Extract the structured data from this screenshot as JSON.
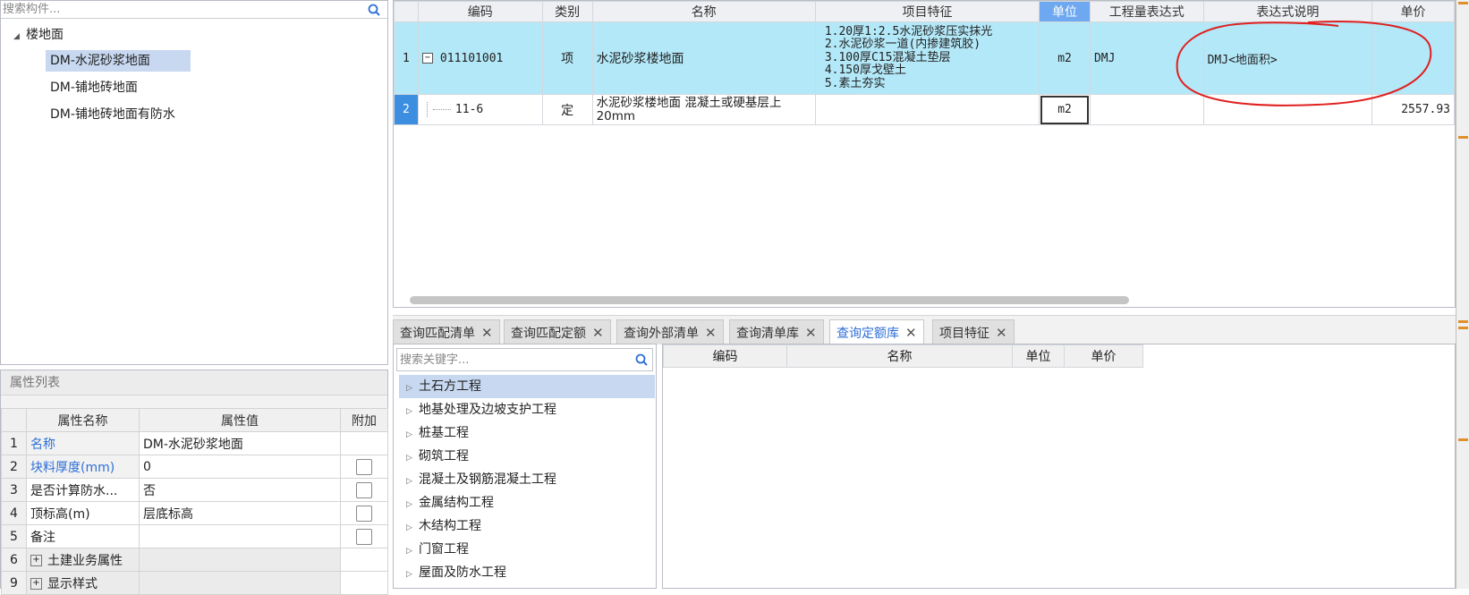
{
  "component_search": {
    "placeholder": "搜索构件..."
  },
  "tree": {
    "root": "楼地面",
    "items": [
      "DM-水泥砂浆地面",
      "DM-铺地砖地面",
      "DM-铺地砖地面有防水"
    ]
  },
  "properties": {
    "title": "属性列表",
    "headers": [
      "属性名称",
      "属性值",
      "附加"
    ],
    "rows": [
      {
        "num": "1",
        "name": "名称",
        "value": "DM-水泥砂浆地面"
      },
      {
        "num": "2",
        "name": "块料厚度(mm)",
        "value": "0"
      },
      {
        "num": "3",
        "name": "是否计算防水...",
        "value": "否"
      },
      {
        "num": "4",
        "name": "顶标高(m)",
        "value": "层底标高"
      },
      {
        "num": "5",
        "name": "备注",
        "value": ""
      },
      {
        "num": "6",
        "name": "土建业务属性",
        "value": ""
      },
      {
        "num": "9",
        "name": "显示样式",
        "value": ""
      }
    ]
  },
  "grid": {
    "headers": [
      "编码",
      "类别",
      "名称",
      "项目特征",
      "单位",
      "工程量表达式",
      "表达式说明",
      "单价"
    ],
    "rows": [
      {
        "num": "1",
        "code": "011101001",
        "type": "项",
        "name": "水泥砂浆楼地面",
        "features": [
          "1.20厚1:2.5水泥砂浆压实抹光",
          "2.水泥砂浆一道(内掺建筑胶)",
          "3.100厚C15混凝土垫层",
          "4.150厚戈壁土",
          "5.素土夯实"
        ],
        "unit": "m2",
        "expr": "DMJ",
        "expr_desc": "DMJ<地面积>",
        "price": ""
      },
      {
        "num": "2",
        "code": "11-6",
        "type": "定",
        "name": "水泥砂浆楼地面 混凝土或硬基层上 20mm",
        "features": [],
        "unit": "m2",
        "expr": "",
        "expr_desc": "",
        "price": "2557.93"
      }
    ]
  },
  "tabs": [
    {
      "label": "查询匹配清单",
      "active": false
    },
    {
      "label": "查询匹配定额",
      "active": false
    },
    {
      "label": "查询外部清单",
      "active": false
    },
    {
      "label": "查询清单库",
      "active": false
    },
    {
      "label": "查询定额库",
      "active": true
    },
    {
      "label": "项目特征",
      "active": false
    }
  ],
  "quota_search": {
    "placeholder": "搜索关键字..."
  },
  "categories": [
    "土石方工程",
    "地基处理及边坡支护工程",
    "桩基工程",
    "砌筑工程",
    "混凝土及钢筋混凝土工程",
    "金属结构工程",
    "木结构工程",
    "门窗工程",
    "屋面及防水工程"
  ],
  "quota_table": {
    "headers": [
      "编码",
      "名称",
      "单位",
      "单价"
    ]
  },
  "colors": {
    "selected_row": "#b3e8f8",
    "accent": "#2f6fd6",
    "annotation": "#e02020",
    "tree_selection": "#c7d8f0"
  },
  "icons": [
    "search-icon",
    "expand-triangle-icon",
    "collapse-triangle-icon",
    "minus-box-icon",
    "plus-box-icon",
    "close-icon",
    "checkbox-icon"
  ]
}
